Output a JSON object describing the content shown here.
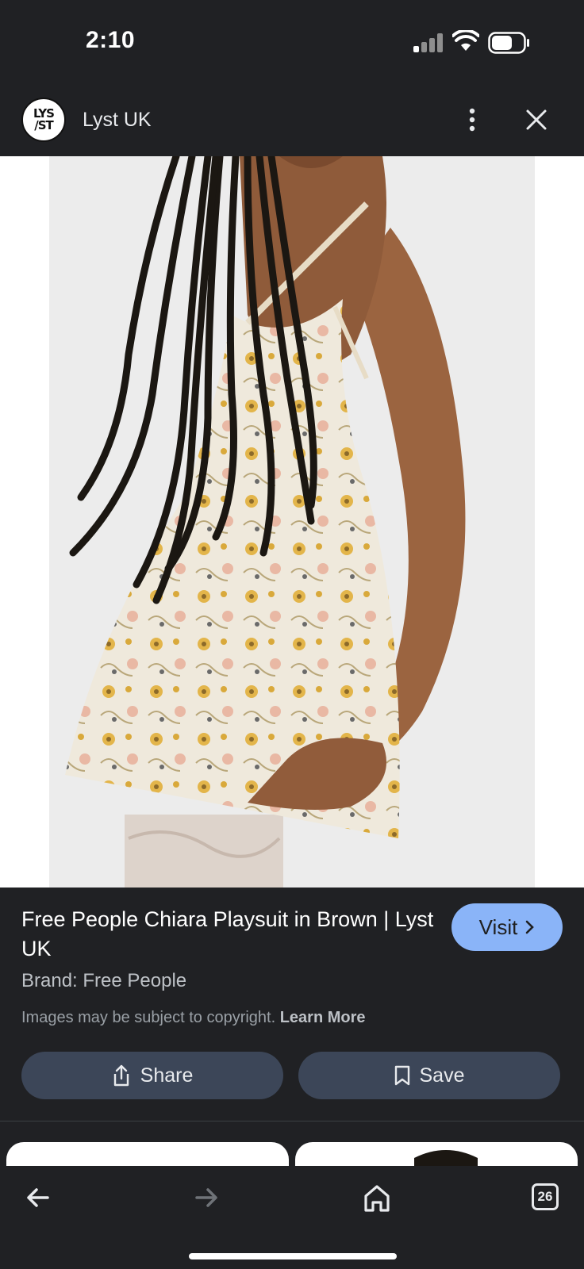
{
  "status_bar": {
    "time": "2:10"
  },
  "header": {
    "logo_text_line1": "LYS",
    "logo_text_line2": "/ST",
    "site_title": "Lyst UK"
  },
  "product": {
    "title": "Free People Chiara Playsuit in Brown | Lyst UK",
    "brand": "Brand: Free People",
    "copyright_text": "Images may be subject to copyright.",
    "learn_more": "Learn More"
  },
  "actions": {
    "visit_label": "Visit",
    "share_label": "Share",
    "save_label": "Save"
  },
  "bottom_nav": {
    "tabs_count": "26"
  },
  "colors": {
    "background": "#202124",
    "accent": "#8ab4f8",
    "button": "#3c4658"
  }
}
